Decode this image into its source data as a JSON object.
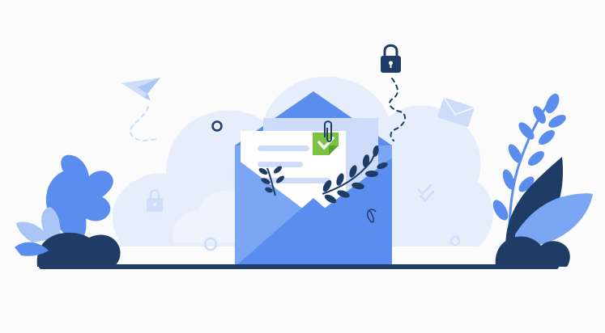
{
  "illustration": {
    "theme": "secure-email-verified",
    "icons": [
      "paper-plane-icon",
      "padlock-icon",
      "envelope-icon",
      "open-envelope-icon",
      "checkmark-badge-icon",
      "paperclip-icon",
      "double-check-icon",
      "padlock-icon"
    ],
    "colors": {
      "background": "#fbfbfc",
      "blob": "#e6eefc",
      "blob_light": "#eef3fd",
      "blue_primary": "#5b8def",
      "blue_mid": "#7aa6f3",
      "blue_light": "#a9c6f7",
      "blue_pale": "#cddcf9",
      "navy": "#1f3c66",
      "navy_dark": "#17335a",
      "green_check": "#7cc243",
      "paper": "#ffffff",
      "ground": "#1f3c66"
    }
  }
}
